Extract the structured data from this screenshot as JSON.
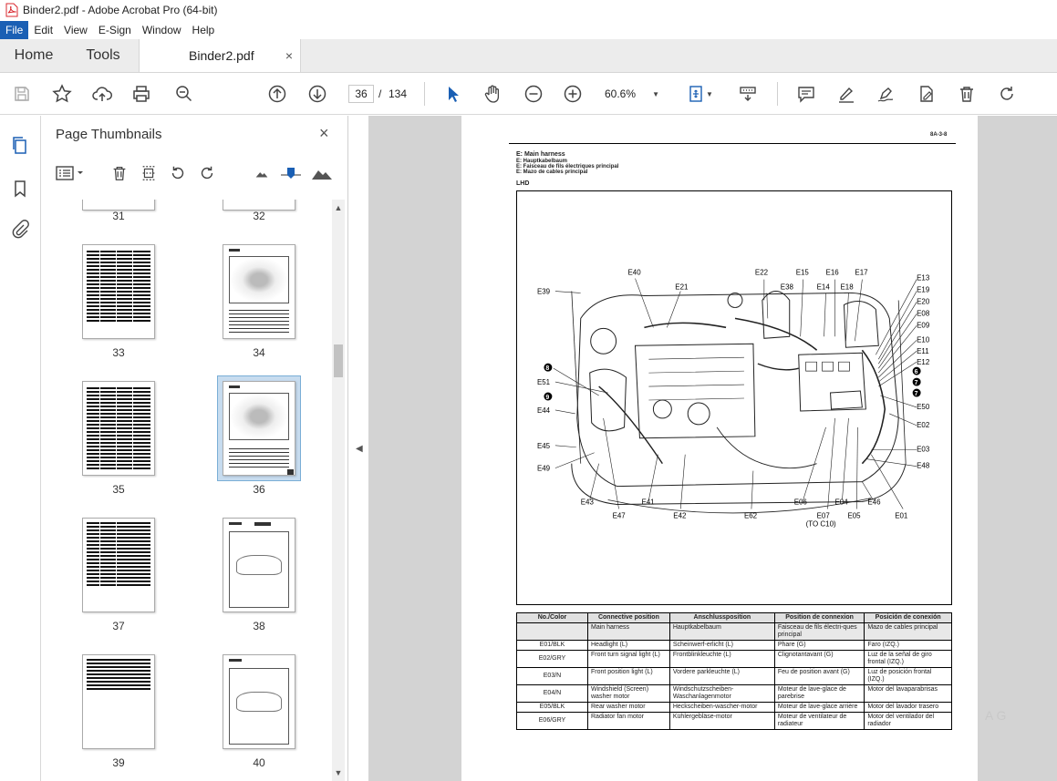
{
  "window": {
    "title": "Binder2.pdf - Adobe Acrobat Pro (64-bit)"
  },
  "menu": [
    "File",
    "Edit",
    "View",
    "E-Sign",
    "Window",
    "Help"
  ],
  "tabs": {
    "home": "Home",
    "tools": "Tools",
    "document": "Binder2.pdf",
    "close": "×"
  },
  "toolbar": {
    "current_page": "36",
    "separator": "/",
    "total_pages": "134",
    "zoom": "60.6%"
  },
  "panel": {
    "title": "Page Thumbnails",
    "close": "×",
    "thumbnails": [
      {
        "label": "31"
      },
      {
        "label": "32"
      },
      {
        "label": "33"
      },
      {
        "label": "34"
      },
      {
        "label": "35"
      },
      {
        "label": "36"
      },
      {
        "label": "37"
      },
      {
        "label": "38"
      },
      {
        "label": "39"
      },
      {
        "label": "40"
      }
    ],
    "selected_page": "36"
  },
  "page": {
    "page_ref": "8A-3-8",
    "heading": [
      "E: Main harness",
      "E: Hauptkabelbaum",
      "E: Faisceau de fils électriques principal",
      "E: Mazo de cables principal"
    ],
    "variant": "LHD",
    "diagram_labels": {
      "top": [
        "E40",
        "E21",
        "E22",
        "E38",
        "E15",
        "E14",
        "E16",
        "E18",
        "E17"
      ],
      "right": [
        "E13",
        "E19",
        "E20",
        "E08",
        "E09",
        "E10",
        "E11",
        "E12",
        "E50",
        "E02",
        "E03",
        "E48"
      ],
      "left": [
        "E39",
        "E51",
        "E44",
        "E45",
        "E49"
      ],
      "bottom": [
        "E43",
        "E47",
        "E41",
        "E42",
        "E62",
        "E06",
        "E07",
        "(TO C10)",
        "E04",
        "E05",
        "E46",
        "E01"
      ],
      "circled": [
        "8",
        "9",
        "6",
        "7",
        "7"
      ]
    },
    "table": {
      "headers": [
        "No./Color",
        "Connective position",
        "Anschlussposition",
        "Position de connexion",
        "Posición de conexión"
      ],
      "subheader": [
        "",
        "Main harness",
        "Hauptkabelbaum",
        "Faisceau de fils électri-ques principal",
        "Mazo de cables principal"
      ],
      "rows": [
        [
          "E01/BLK",
          "Headlight (L)",
          "Scheinwerf-erlicht (L)",
          "Phare (G)",
          "Faro (IZQ.)"
        ],
        [
          "E02/GRY",
          "Front turn signal light (L)",
          "Frontblinkleuchte (L)",
          "Clignotantavant (G)",
          "Luz de la señal de giro frontal (IZQ.)"
        ],
        [
          "E03/N",
          "Front position light (L)",
          "Vordere parkleuchte (L)",
          "Feu de position avant (G)",
          "Luz de posición frontal (IZQ.)"
        ],
        [
          "E04/N",
          "Windshield (Screen) washer motor",
          "Windschutzscheiben-Waschanlagenmotor",
          "Moteur de lave-glace de parebrise",
          "Motor del lavaparabrisas"
        ],
        [
          "E05/BLK",
          "Rear washer motor",
          "Heckscheiben-wascher-motor",
          "Moteur de lave-glace arrière",
          "Motor del lavador trasero"
        ],
        [
          "E06/GRY",
          "Radiator fan motor",
          "Kühlergebläse-motor",
          "Moteur de ventilateur de radiateur",
          "Motor del ventilador del radiador"
        ]
      ]
    }
  },
  "watermark": "A G"
}
